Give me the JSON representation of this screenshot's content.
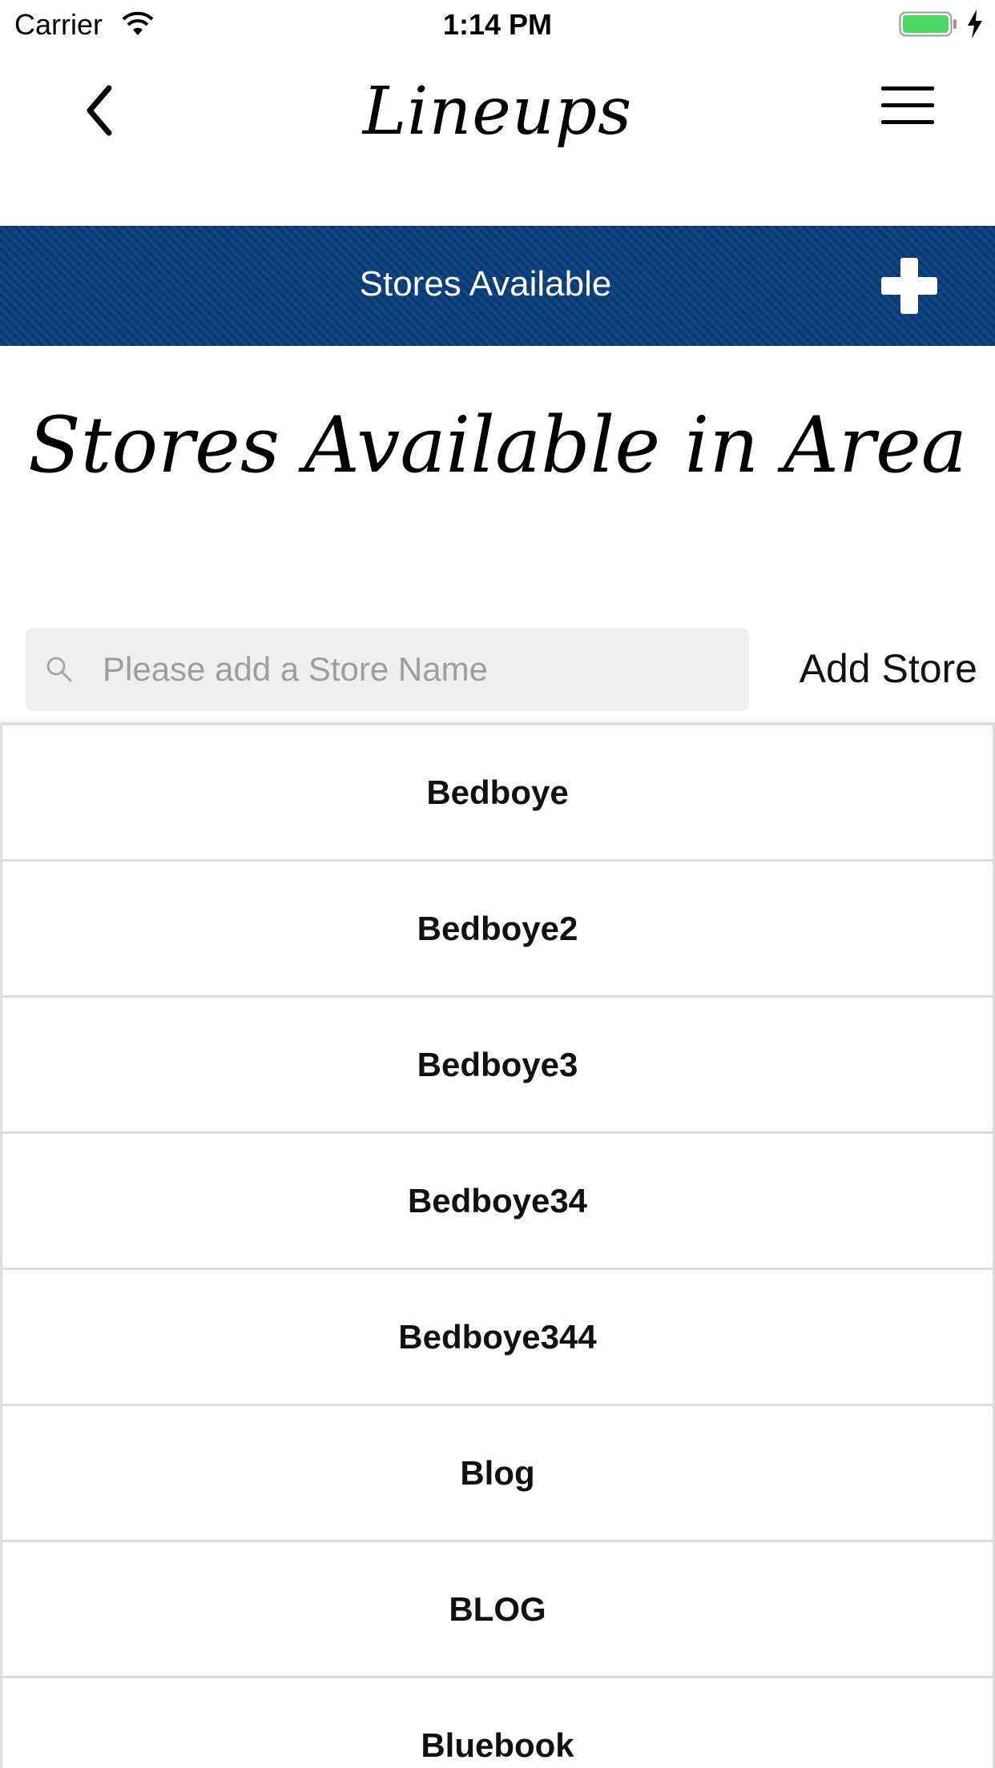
{
  "status_bar": {
    "carrier": "Carrier",
    "time": "1:14 PM",
    "battery_color": "#4cd964"
  },
  "nav": {
    "title": "Lineups",
    "back_icon": "chevron-left-icon",
    "menu_icon": "hamburger-menu-icon"
  },
  "header": {
    "title": "Stores Available",
    "add_icon": "plus-icon",
    "background_color": "#083b7a"
  },
  "page": {
    "title": "Stores Available in Area"
  },
  "search": {
    "placeholder": "Please add a Store Name",
    "value": "",
    "add_button_label": "Add Store"
  },
  "stores": [
    {
      "name": "Bedboye"
    },
    {
      "name": "Bedboye2"
    },
    {
      "name": "Bedboye3"
    },
    {
      "name": "Bedboye34"
    },
    {
      "name": "Bedboye344"
    },
    {
      "name": "Blog"
    },
    {
      "name": "BLOG"
    },
    {
      "name": "Bluebook"
    }
  ]
}
